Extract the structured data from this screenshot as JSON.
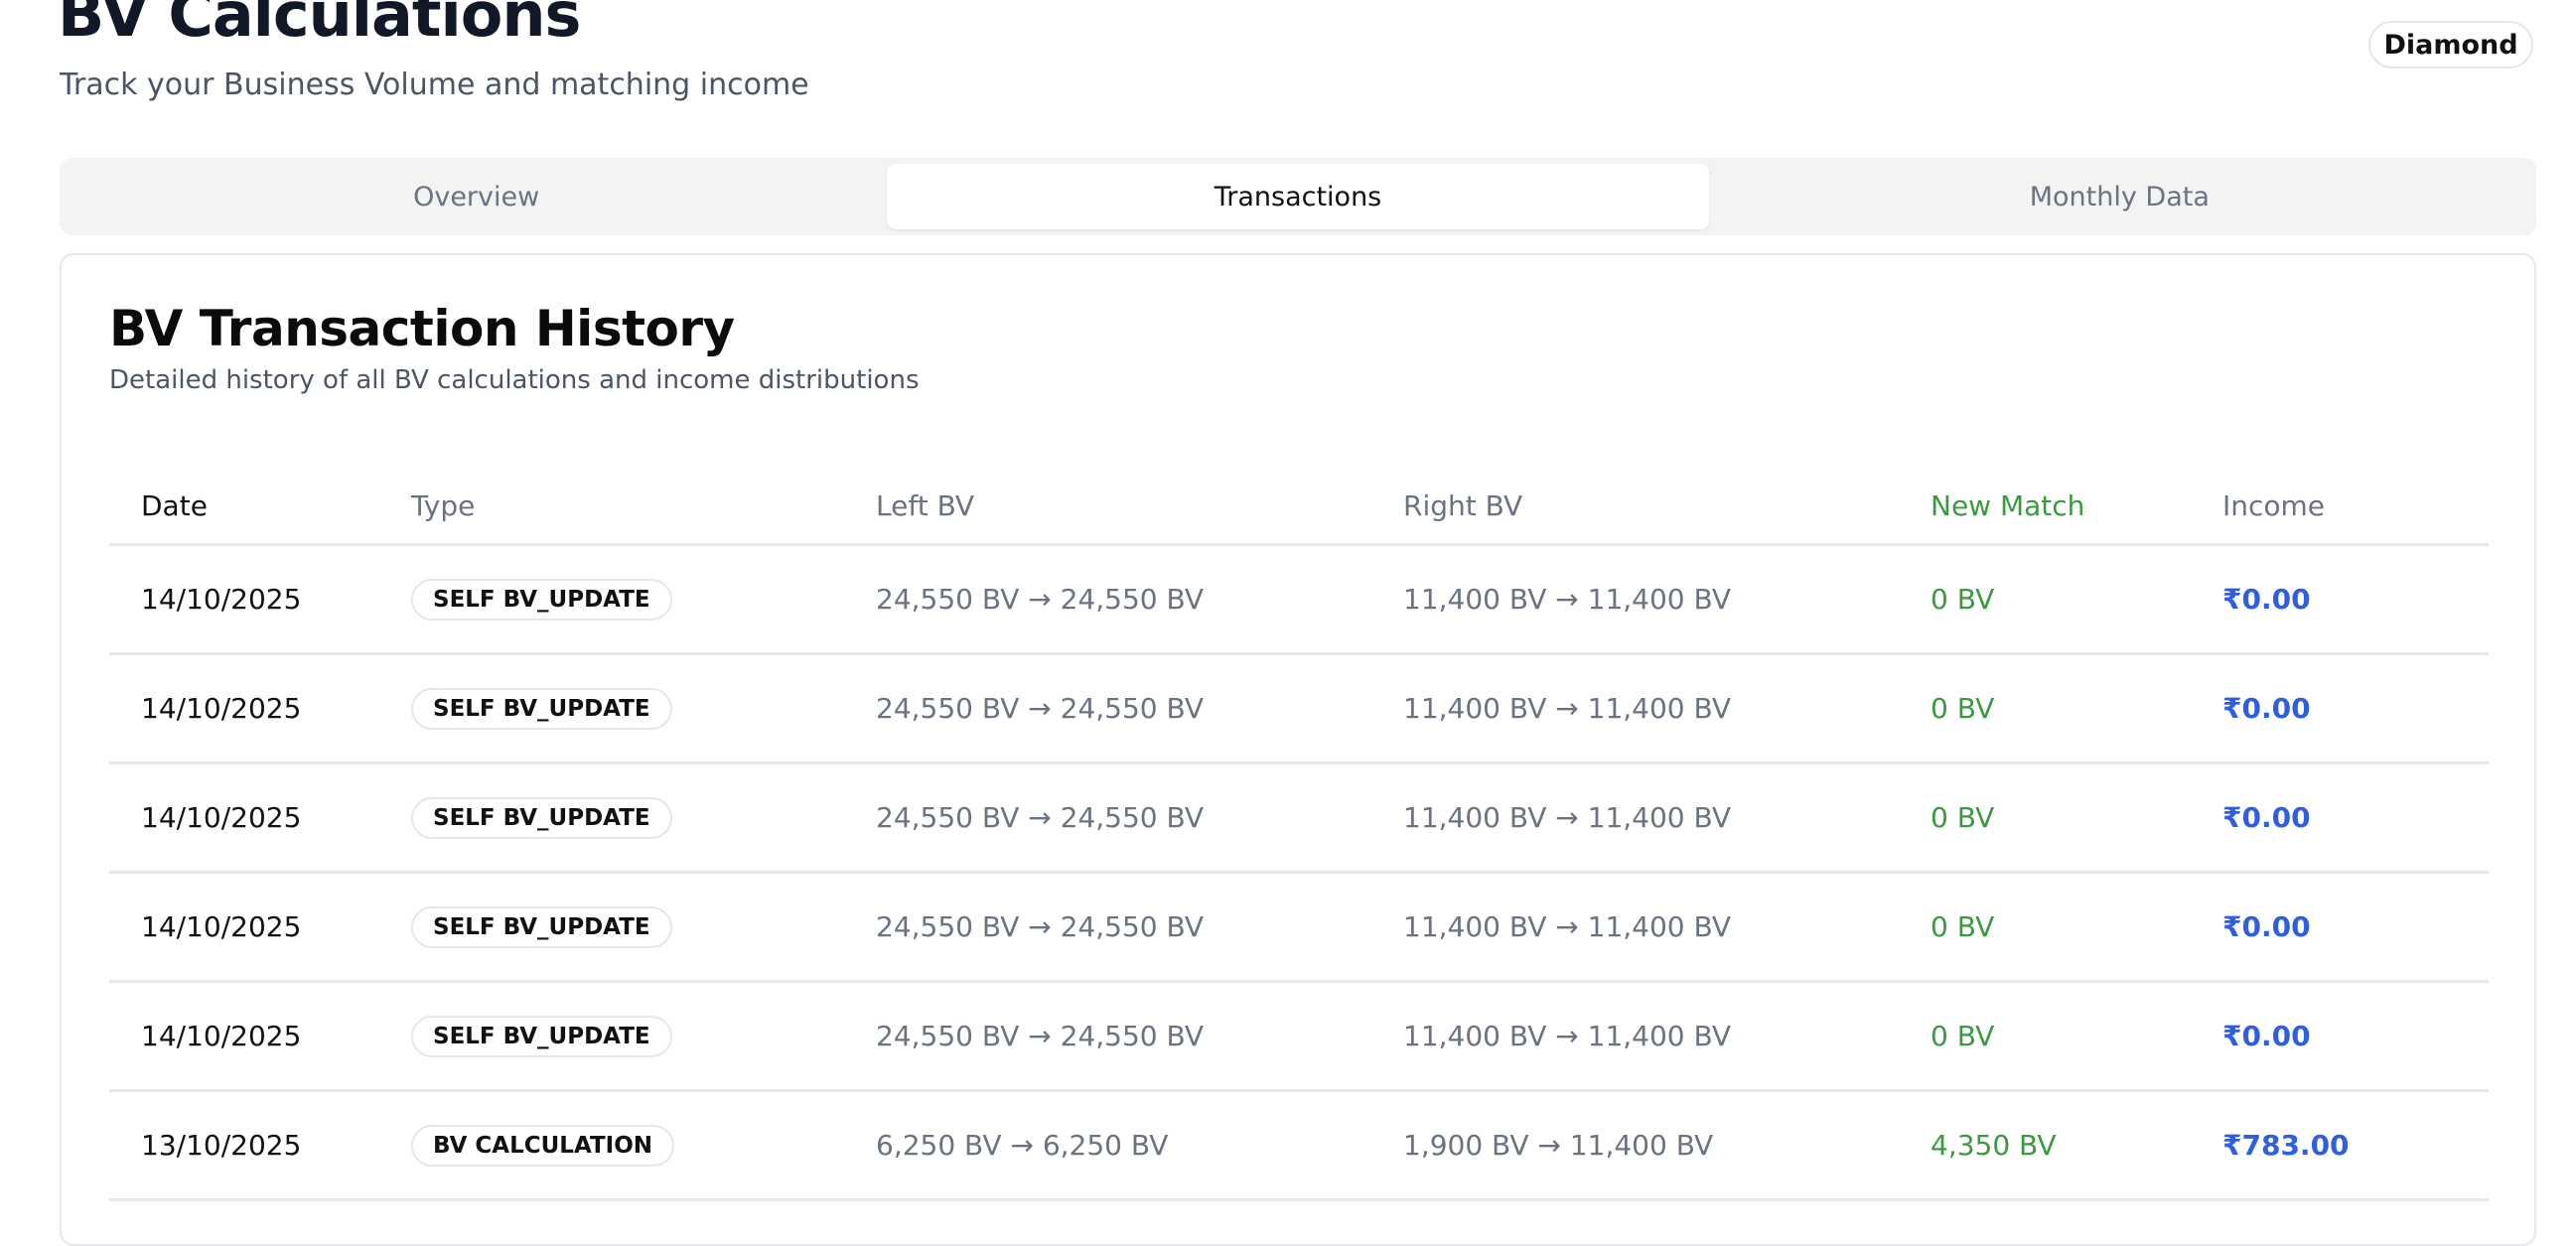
{
  "header": {
    "title": "BV Calculations",
    "subtitle": "Track your Business Volume and matching income",
    "rank_badge": "Diamond"
  },
  "tabs": [
    {
      "label": "Overview"
    },
    {
      "label": "Transactions",
      "active": true
    },
    {
      "label": "Monthly Data"
    }
  ],
  "card": {
    "title": "BV Transaction History",
    "description": "Detailed history of all BV calculations and income distributions"
  },
  "table": {
    "columns": [
      "Date",
      "Type",
      "Left BV",
      "Right BV",
      "New Match",
      "Income"
    ],
    "rows": [
      {
        "date": "14/10/2025",
        "type": "SELF BV_UPDATE",
        "left": "24,550 BV → 24,550 BV",
        "right": "11,400 BV → 11,400 BV",
        "match": "0 BV",
        "income": "₹0.00"
      },
      {
        "date": "14/10/2025",
        "type": "SELF BV_UPDATE",
        "left": "24,550 BV → 24,550 BV",
        "right": "11,400 BV → 11,400 BV",
        "match": "0 BV",
        "income": "₹0.00"
      },
      {
        "date": "14/10/2025",
        "type": "SELF BV_UPDATE",
        "left": "24,550 BV → 24,550 BV",
        "right": "11,400 BV → 11,400 BV",
        "match": "0 BV",
        "income": "₹0.00"
      },
      {
        "date": "14/10/2025",
        "type": "SELF BV_UPDATE",
        "left": "24,550 BV → 24,550 BV",
        "right": "11,400 BV → 11,400 BV",
        "match": "0 BV",
        "income": "₹0.00"
      },
      {
        "date": "14/10/2025",
        "type": "SELF BV_UPDATE",
        "left": "24,550 BV → 24,550 BV",
        "right": "11,400 BV → 11,400 BV",
        "match": "0 BV",
        "income": "₹0.00"
      },
      {
        "date": "13/10/2025",
        "type": "BV CALCULATION",
        "left": "6,250 BV → 6,250 BV",
        "right": "1,900 BV → 11,400 BV",
        "match": "4,350 BV",
        "income": "₹783.00"
      }
    ]
  },
  "colors": {
    "match": "#3a9a3f",
    "income": "#2f5fe0"
  }
}
